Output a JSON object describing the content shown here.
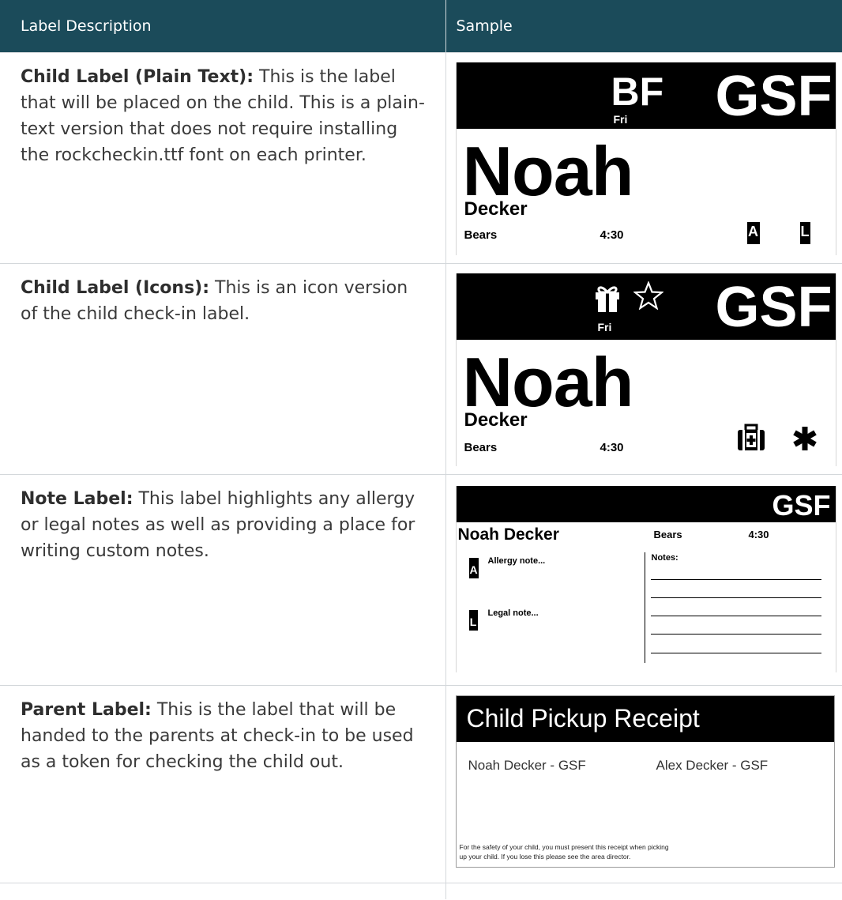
{
  "header": {
    "col1": "Label Description",
    "col2": "Sample"
  },
  "rows": [
    {
      "title": "Child Label (Plain Text):",
      "text": " This is the label that will be placed on the child. This is a plain-text version that does not require installing the rockcheckin.ttf font on each printer.",
      "sample": {
        "badge": "BF",
        "day": "Fri",
        "code": "GSF",
        "first_name": "Noah",
        "last_name": "Decker",
        "group": "Bears",
        "time": "4:30",
        "flag_a": "A",
        "flag_l": "L"
      }
    },
    {
      "title": "Child Label (Icons):",
      "text": " This is an icon version of the child check-in label.",
      "sample": {
        "icons": [
          "gift-icon",
          "star-icon"
        ],
        "day": "Fri",
        "code": "GSF",
        "first_name": "Noah",
        "last_name": "Decker",
        "group": "Bears",
        "time": "4:30",
        "flag_icons": [
          "medical-kit-icon",
          "asterisk-icon"
        ]
      }
    },
    {
      "title": "Note Label:",
      "text": " This label highlights any allergy or legal notes as well as providing a place for writing custom notes.",
      "sample": {
        "code": "GSF",
        "full_name": "Noah Decker",
        "group": "Bears",
        "time": "4:30",
        "flag_a": "A",
        "allergy_note": "Allergy note...",
        "flag_l": "L",
        "legal_note": "Legal note...",
        "notes_heading": "Notes:"
      }
    },
    {
      "title": "Parent Label:",
      "text": " This is the label that will be handed to the parents at check-in to be used as a token for checking the child out.",
      "sample": {
        "heading": "Child Pickup Receipt",
        "child": "Noah Decker - GSF",
        "sibling": "Alex Decker - GSF",
        "footer_line1": "For the safety of your child, you must present this receipt when picking",
        "footer_line2": "up your child. If you lose this please see the area director."
      }
    }
  ],
  "colors": {
    "header_bg": "#1b4b5a",
    "header_text": "#ffffff",
    "border": "#d4d8db",
    "label_black": "#000000"
  }
}
